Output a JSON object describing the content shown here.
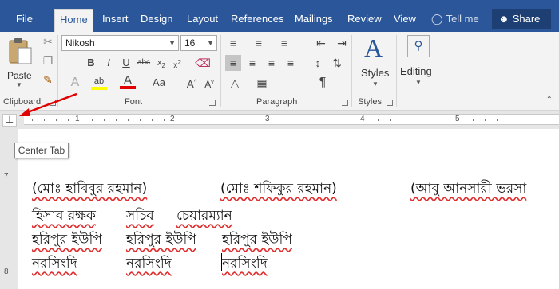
{
  "tabs": [
    "File",
    "Home",
    "Insert",
    "Design",
    "Layout",
    "References",
    "Mailings",
    "Review",
    "View",
    "Tell me"
  ],
  "share_label": "Share",
  "ribbon": {
    "font_name": "Nikosh",
    "font_size": "16",
    "paste_label": "Paste",
    "styles_label": "Styles",
    "editing_label": "Editing",
    "groups": [
      "Clipboard",
      "Font",
      "Paragraph",
      "Styles"
    ]
  },
  "ruler_numbers": [
    "1",
    "2",
    "3",
    "4",
    "5"
  ],
  "vruler_numbers": [
    "7",
    "8"
  ],
  "tooltip": "Center Tab",
  "document": {
    "lines": [
      [
        "(মোঃ হাবিবুর রহমান)",
        "(মোঃ শফিকুর রহমান)",
        "(আবু আনসারী ভরসা"
      ],
      [
        "হিসাব রক্ষক",
        "সচিব",
        "চেয়ারম্যান"
      ],
      [
        "হরিপুর ইউপি",
        "হরিপুর ইউপি",
        "হরিপুর ইউপি"
      ],
      [
        "নরসিংদি",
        "নরসিংদি",
        "নরসিংদি"
      ]
    ]
  },
  "colors": {
    "accent": "#2b579a",
    "highlight": "#ffff00",
    "font_color": "#e00000",
    "annotation_arrow": "#e00000"
  }
}
